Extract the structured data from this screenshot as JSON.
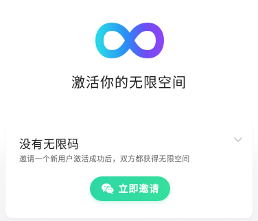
{
  "hero": {
    "logo_icon": "infinity-logo-icon",
    "title": "激活你的无限空间"
  },
  "invite_card": {
    "title": "没有无限码",
    "subtitle": "邀请一个新用户激活成功后，双方都获得无限空间",
    "expand_icon": "chevron-down-icon",
    "button": {
      "icon": "wechat-icon",
      "label": "立即邀请"
    }
  },
  "colors": {
    "accent_green": "#2ED8A5",
    "logo_blue": "#2B8CF6",
    "logo_purple": "#8A46F5",
    "logo_cyan": "#29D5E8"
  }
}
